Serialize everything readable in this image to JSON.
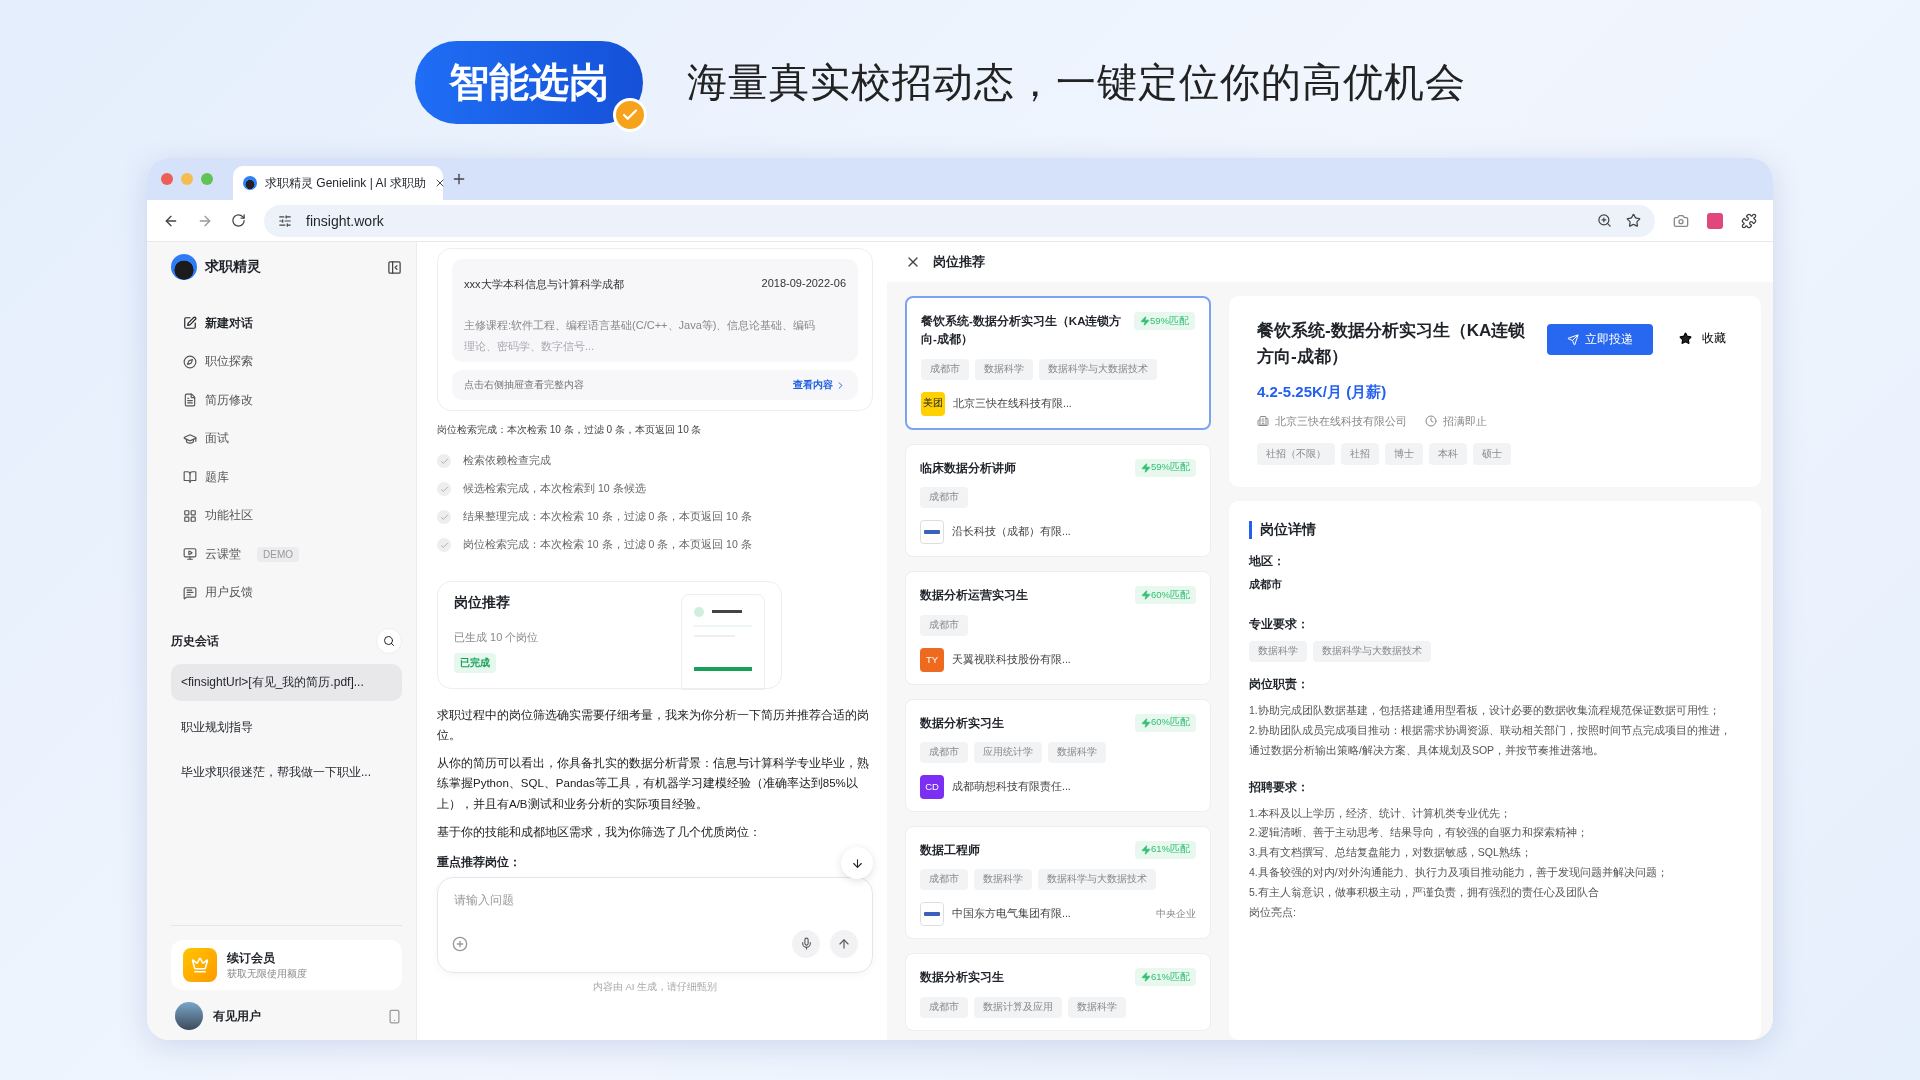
{
  "banner": {
    "badge": "智能选岗",
    "headline": "海量真实校招动态，一键定位你的高优机会"
  },
  "browser": {
    "tab_title": "求职精灵 Genielink | AI 求职助",
    "url": "finsight.work"
  },
  "sidebar": {
    "brand": "求职精灵",
    "nav": [
      {
        "label": "新建对话"
      },
      {
        "label": "职位探索"
      },
      {
        "label": "简历修改"
      },
      {
        "label": "面试"
      },
      {
        "label": "题库"
      },
      {
        "label": "功能社区"
      },
      {
        "label": "云课堂",
        "badge": "DEMO"
      },
      {
        "label": "用户反馈"
      }
    ],
    "history_title": "历史会话",
    "history": [
      {
        "label": "<finsightUrl>[有见_我的简历.pdf]...",
        "selected": true
      },
      {
        "label": "职业规划指导",
        "selected": false
      },
      {
        "label": "毕业求职很迷茫，帮我做一下职业...",
        "selected": false
      }
    ],
    "member": {
      "title": "续订会员",
      "subtitle": "获取无限使用额度"
    },
    "user": "有见用户"
  },
  "chat": {
    "resume": {
      "school": "xxx大学本科信息与计算科学成都",
      "dates": "2018-09-2022-06",
      "courses": "主修课程:软件工程、编程语言基础(C/C++、Java等)、信息论基础、编码",
      "courses_faded": "理论、密码学、数字信号...",
      "drawer_hint": "点击右侧抽屉查看完整内容",
      "view_link": "查看内容"
    },
    "search_summary": "岗位检索完成：本次检索 10 条，过滤 0 条，本页返回 10 条",
    "steps": [
      "检索依赖检查完成",
      "候选检索完成，本次检索到 10 条候选",
      "结果整理完成：本次检索 10 条，过滤 0 条，本页返回 10 条",
      "岗位检索完成：本次检索 10 条，过滤 0 条，本页返回 10 条"
    ],
    "rec_card": {
      "title": "岗位推荐",
      "count": "已生成 10 个岗位",
      "status": "已完成"
    },
    "paragraphs": [
      "求职过程中的岗位筛选确实需要仔细考量，我来为你分析一下简历并推荐合适的岗位。",
      "从你的简历可以看出，你具备扎实的数据分析背景：信息与计算科学专业毕业，熟练掌握Python、SQL、Pandas等工具，有机器学习建模经验（准确率达到85%以上），并且有A/B测试和业务分析的实际项目经验。",
      "基于你的技能和成都地区需求，我为你筛选了几个优质岗位："
    ],
    "emphasis": "重点推荐岗位：",
    "input": {
      "placeholder": "请输入问题"
    },
    "disclaimer": "内容由 AI 生成，请仔细甄别"
  },
  "jobs_panel": {
    "title": "岗位推荐",
    "jobs": [
      {
        "title": "餐饮系统-数据分析实习生（KA连锁方向-成都）",
        "match": "59%匹配",
        "tags": [
          "成都市",
          "数据科学",
          "数据科学与大数据技术"
        ],
        "company": "北京三快在线科技有限...",
        "logo": {
          "kind": "text",
          "text": "美团",
          "color": "#ffd100"
        },
        "selected": true
      },
      {
        "title": "临床数据分析讲师",
        "match": "59%匹配",
        "tags": [
          "成都市"
        ],
        "company": "沿长科技（成都）有限...",
        "logo": {
          "kind": "image"
        },
        "selected": false
      },
      {
        "title": "数据分析运营实习生",
        "match": "60%匹配",
        "tags": [
          "成都市"
        ],
        "company": "天翼视联科技股份有限...",
        "logo": {
          "kind": "text",
          "text": "TY",
          "color": "#ee6a1f"
        },
        "selected": false
      },
      {
        "title": "数据分析实习生",
        "match": "60%匹配",
        "tags": [
          "成都市",
          "应用统计学",
          "数据科学"
        ],
        "company": "成都萌想科技有限责任...",
        "logo": {
          "kind": "text",
          "text": "CD",
          "color": "#7b2ff2"
        },
        "selected": false
      },
      {
        "title": "数据工程师",
        "match": "61%匹配",
        "tags": [
          "成都市",
          "数据科学",
          "数据科学与大数据技术"
        ],
        "company": "中国东方电气集团有限...",
        "logo": {
          "kind": "image"
        },
        "note": "中央企业",
        "selected": false
      },
      {
        "title": "数据分析实习生",
        "match": "61%匹配",
        "tags": [
          "成都市",
          "数据计算及应用",
          "数据科学"
        ],
        "selected": false
      }
    ]
  },
  "detail": {
    "title": "餐饮系统-数据分析实习生（KA连锁方向-成都）",
    "apply": "立即投递",
    "save": "收藏",
    "salary": "4.2-5.25K/月 (月薪)",
    "company": "北京三快在线科技有限公司",
    "status": "招满即止",
    "tags": [
      "社招（不限）",
      "社招",
      "博士",
      "本科",
      "硕士"
    ],
    "section_title": "岗位详情",
    "region_label": "地区：",
    "region": "成都市",
    "major_label": "专业要求：",
    "majors": [
      "数据科学",
      "数据科学与大数据技术"
    ],
    "duties_label": "岗位职责：",
    "duties": [
      "1.协助完成团队数据基建，包括搭建通用型看板，设计必要的数据收集流程规范保证数据可用性；",
      "2.协助团队成员完成项目推动：根据需求协调资源、联动相关部门，按照时间节点完成项目的推进，通过数据分析输出策略/解决方案、具体规划及SOP，并按节奏推进落地。"
    ],
    "req_label": "招聘要求：",
    "reqs": [
      "1.本科及以上学历，经济、统计、计算机类专业优先；",
      "2.逻辑清晰、善于主动思考、结果导向，有较强的自驱力和探索精神；",
      "3.具有文档撰写、总结复盘能力，对数据敏感，SQL熟练；",
      "4.具备较强的对内/对外沟通能力、执行力及项目推动能力，善于发现问题并解决问题；",
      "5.有主人翁意识，做事积极主动，严谨负责，拥有强烈的责任心及团队合"
    ],
    "highlights_label": "岗位亮点:"
  }
}
